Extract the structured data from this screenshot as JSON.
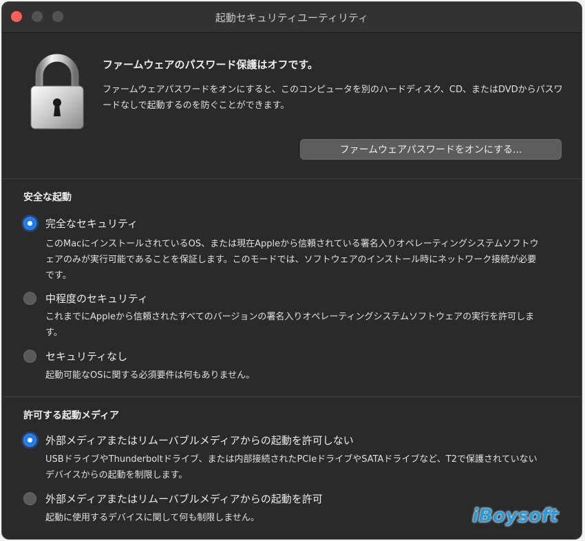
{
  "window": {
    "title": "起動セキュリティユーティリティ"
  },
  "firmware": {
    "heading": "ファームウェアのパスワード保護はオフです。",
    "description": "ファームウェアパスワードをオンにすると、このコンピュータを別のハードディスク、CD、またはDVDからパスワードなしで起動するのを防ぐことができます。",
    "button_label": "ファームウェアパスワードをオンにする..."
  },
  "secure_boot": {
    "title": "安全な起動",
    "options": [
      {
        "label": "完全なセキュリティ",
        "description": "このMacにインストールされているOS、または現在Appleから信頼されている署名入りオペレーティングシステムソフトウェアのみが実行可能であることを保証します。このモードでは、ソフトウェアのインストール時にネットワーク接続が必要です。",
        "selected": true
      },
      {
        "label": "中程度のセキュリティ",
        "description": "これまでにAppleから信頼されたすべてのバージョンの署名入りオペレーティングシステムソフトウェアの実行を許可します。",
        "selected": false
      },
      {
        "label": "セキュリティなし",
        "description": "起動可能なOSに関する必須要件は何もありません。",
        "selected": false
      }
    ]
  },
  "boot_media": {
    "title": "許可する起動メディア",
    "options": [
      {
        "label": "外部メディアまたはリムーバブルメディアからの起動を許可しない",
        "description": "USBドライブやThunderboltドライブ、または内部接続されたPCIeドライブやSATAドライブなど、T2で保護されていないデバイスからの起動を制限します。",
        "selected": true
      },
      {
        "label": "外部メディアまたはリムーバブルメディアからの起動を許可",
        "description": "起動に使用するデバイスに関して何も制限しません。",
        "selected": false
      }
    ]
  },
  "watermark": "iBoysoft",
  "colors": {
    "accent": "#1f7cf0",
    "window_bg": "#2a2a2a",
    "close_button": "#fe5f57"
  }
}
